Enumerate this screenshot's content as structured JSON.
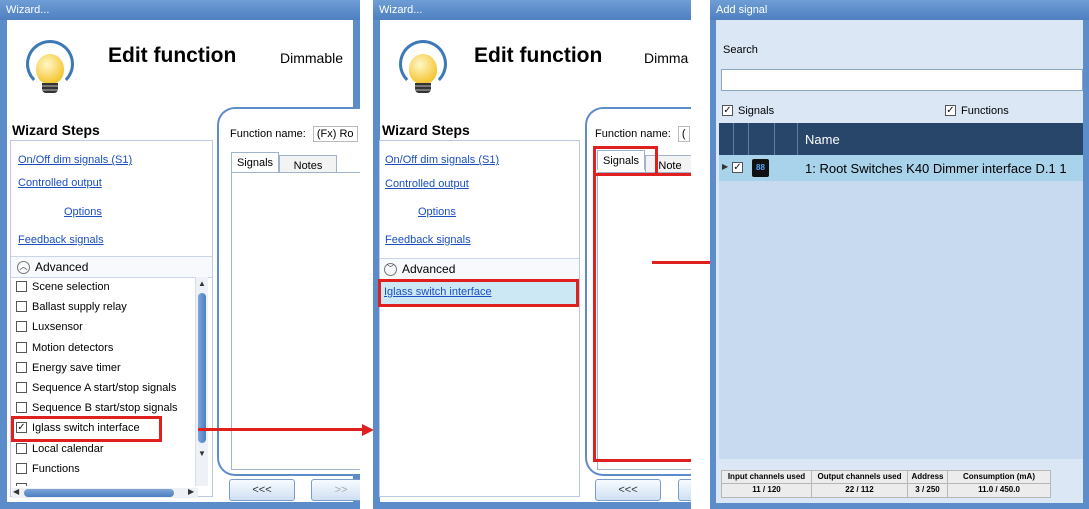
{
  "panel1": {
    "title": "Wizard...",
    "heading": "Edit function",
    "subheading": "Dimmable",
    "wizard_steps_title": "Wizard Steps",
    "steps": [
      "On/Off dim signals (S1)",
      "Controlled output",
      "Options",
      "Feedback signals"
    ],
    "advanced_label": "Advanced",
    "checkboxes": [
      {
        "label": "Scene selection",
        "checked": false
      },
      {
        "label": "Ballast supply relay",
        "checked": false
      },
      {
        "label": "Luxsensor",
        "checked": false
      },
      {
        "label": "Motion detectors",
        "checked": false
      },
      {
        "label": "Energy save timer",
        "checked": false
      },
      {
        "label": "Sequence A start/stop signals",
        "checked": false
      },
      {
        "label": "Sequence B start/stop signals",
        "checked": false
      },
      {
        "label": "Iglass switch interface",
        "checked": true
      },
      {
        "label": "Local calendar",
        "checked": false
      },
      {
        "label": "Functions",
        "checked": false
      }
    ],
    "function_name_label": "Function name:",
    "function_name_value": "(Fx) Ro",
    "tabs": [
      "Signals",
      "Notes"
    ],
    "back_button": "<<<",
    "next_button": ">>"
  },
  "panel2": {
    "title": "Wizard...",
    "heading": "Edit function",
    "subheading": "Dimma",
    "wizard_steps_title": "Wizard Steps",
    "steps": [
      "On/Off dim signals (S1)",
      "Controlled output",
      "Options",
      "Feedback signals"
    ],
    "advanced_label": "Advanced",
    "advanced_item": "Iglass switch interface",
    "function_name_label": "Function name:",
    "function_name_value": "(",
    "tabs": [
      "Signals",
      "Note"
    ],
    "back_button": "<<<"
  },
  "panel3": {
    "title": "Add signal",
    "search_label": "Search",
    "search_value": "",
    "filter_signals": "Signals",
    "filter_functions": "Functions",
    "column_name": "Name",
    "row_text": "1: Root Switches K40 Dimmer interface D.1 1",
    "row_badge": "88",
    "status": {
      "headers": [
        "Input channels used",
        "Output channels used",
        "Address",
        "Consumption (mA)"
      ],
      "values": [
        "11 / 120",
        "22 / 112",
        "3 / 250",
        "11.0 / 450.0"
      ]
    }
  },
  "colors": {
    "accent": "#5d8ccb",
    "highlight": "#e01f1f",
    "grid_header": "#27466a",
    "selected_row": "#a9d3ea"
  }
}
